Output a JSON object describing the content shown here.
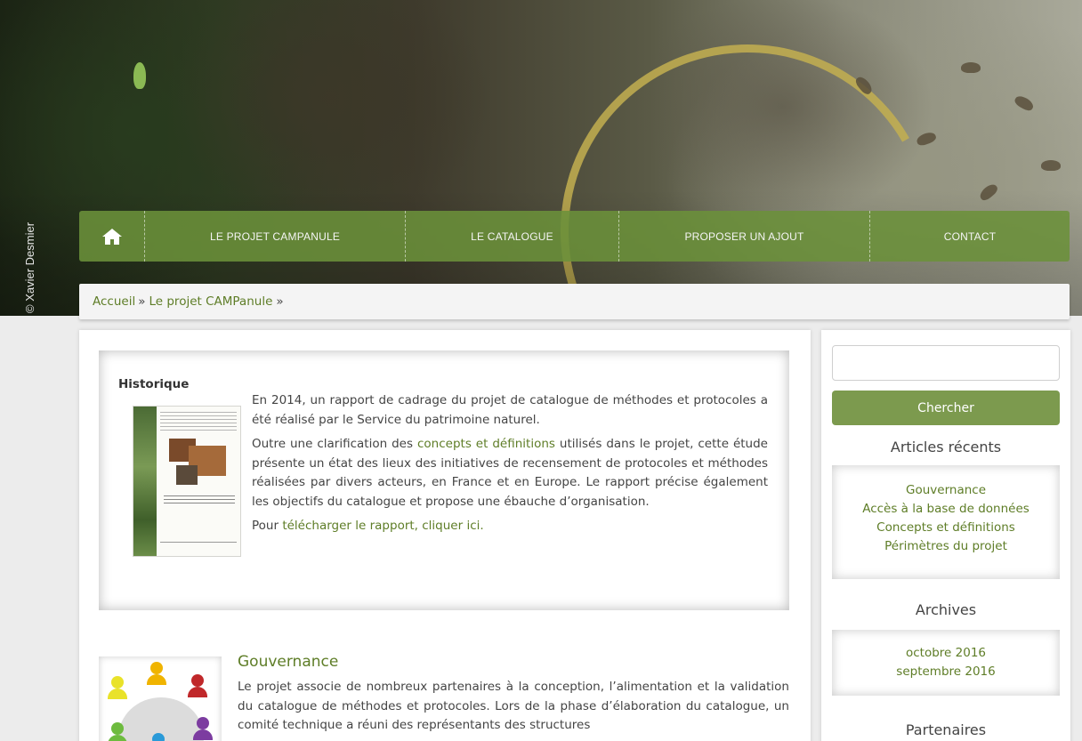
{
  "header": {
    "photo_credit": "© Xavier Desmier"
  },
  "nav": {
    "home_icon": "home-icon",
    "items": [
      {
        "label": "LE PROJET CAMPANULE"
      },
      {
        "label": "LE CATALOGUE"
      },
      {
        "label": "PROPOSER UN AJOUT"
      },
      {
        "label": "CONTACT"
      }
    ]
  },
  "breadcrumb": {
    "home": "Accueil",
    "sep1": "»",
    "current": "Le projet CAMPanule",
    "sep2": "»"
  },
  "historique": {
    "title": "Historique",
    "p1": "En 2014, un rapport de cadrage du projet de catalogue de méthodes et protocoles a été réalisé par le Service du patrimoine naturel.",
    "p2_before": "Outre une clarification des ",
    "p2_link": "concepts et définitions",
    "p2_after": " utilisés dans le projet, cette étude présente un état des lieux des initiatives de recensement de protocoles et méthodes réalisées par divers acteurs, en France et en Europe. Le rapport précise également les objectifs du catalogue et propose une ébauche d’organisation.",
    "p3_before": "Pour ",
    "p3_link": "télécharger le rapport, cliquer ici."
  },
  "gouvernance": {
    "title": "Gouvernance",
    "text": "Le projet associe de nombreux partenaires à la conception, l’alimentation et la validation du catalogue de méthodes et protocoles. Lors de la phase d’élaboration du catalogue, un comité technique a réuni des représentants des structures"
  },
  "sidebar": {
    "search_placeholder": "",
    "search_button": "Chercher",
    "recent_heading": "Articles récents",
    "recent_items": [
      "Gouvernance",
      "Accès à la base de données",
      "Concepts et définitions",
      "Périmètres du projet"
    ],
    "archives_heading": "Archives",
    "archive_items": [
      "octobre 2016",
      "septembre 2016"
    ],
    "partners_heading": "Partenaires"
  },
  "colors": {
    "accent_green": "#5e7d27",
    "nav_green": "#6b913a",
    "button_green": "#7c9a4e"
  }
}
